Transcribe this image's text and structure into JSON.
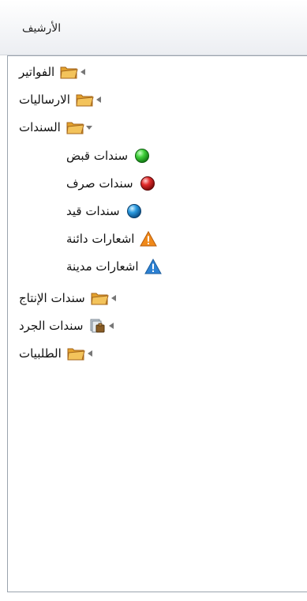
{
  "header": {
    "title": "الأرشيف"
  },
  "tree": {
    "items": [
      {
        "label": "الفواتير"
      },
      {
        "label": "الارساليات"
      },
      {
        "label": "السندات",
        "children": [
          {
            "label": "سندات قبض"
          },
          {
            "label": "سندات صرف"
          },
          {
            "label": "سندات قيد"
          },
          {
            "label": "اشعارات دائنة"
          },
          {
            "label": "اشعارات مدينة"
          }
        ]
      },
      {
        "label": "سندات الإنتاج"
      },
      {
        "label": "سندات الجرد"
      },
      {
        "label": "الطلبيات"
      }
    ]
  },
  "colors": {
    "green": "#2fb52f",
    "red": "#d11d1d",
    "blue": "#2a86d6",
    "warning_orange": "#f08a16",
    "warning_blue": "#2a7fd4",
    "folder": "#f1b340"
  },
  "icons": {
    "folder": "folder-icon",
    "expanded": "triangle-down-icon",
    "collapsed": "triangle-left-icon",
    "green": "green-sphere-icon",
    "red": "red-sphere-icon",
    "blue": "blue-sphere-icon",
    "warn_orange": "warning-orange-icon",
    "warn_blue": "warning-blue-icon",
    "inventory": "inventory-document-icon"
  }
}
